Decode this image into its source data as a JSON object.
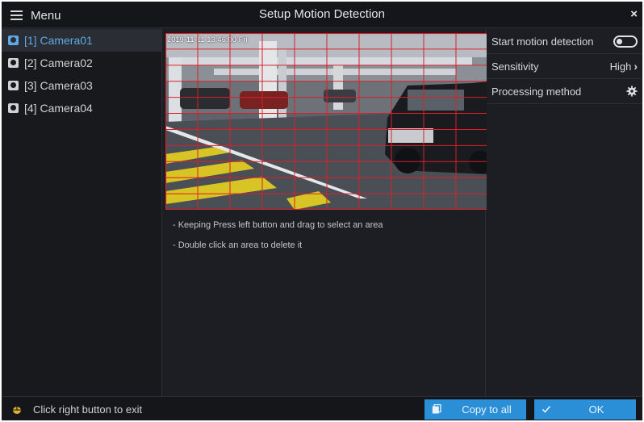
{
  "titlebar": {
    "menu_label": "Menu",
    "title": "Setup Motion Detection",
    "close_symbol": "×"
  },
  "cameras": [
    {
      "label": "[1] Camera01",
      "selected": true
    },
    {
      "label": "[2] Camera02",
      "selected": false
    },
    {
      "label": "[3] Camera03",
      "selected": false
    },
    {
      "label": "[4] Camera04",
      "selected": false
    }
  ],
  "video": {
    "osd_text": "2019-11-11  13:46:00  Fri",
    "grid_columns": 10,
    "grid_rows": 11,
    "grid_color": "#d8202a"
  },
  "hints": {
    "line1": "- Keeping Press left button and drag to select an area",
    "line2": "- Double click an area to delete it"
  },
  "settings": {
    "start_motion_detection_label": "Start motion detection",
    "start_motion_detection_on": false,
    "sensitivity_label": "Sensitivity",
    "sensitivity_value": "High",
    "processing_method_label": "Processing method"
  },
  "footer": {
    "hint": "Click right button to exit",
    "copy_label": "Copy to all",
    "ok_label": "OK"
  },
  "colors": {
    "accent": "#2a8fd6",
    "selected_text": "#5fa9e4",
    "background": "#1c1e23"
  },
  "icons": {
    "menu": "hamburger-icon",
    "close": "close-icon",
    "camera": "camera-icon",
    "gear": "gear-icon",
    "mouse": "mouse-icon",
    "copy": "copy-icon",
    "check": "check-icon"
  }
}
